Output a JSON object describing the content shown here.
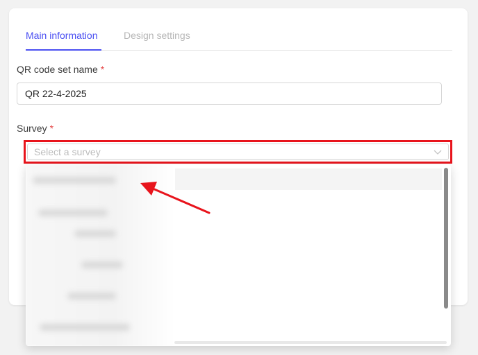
{
  "tabs": [
    {
      "label": "Main information",
      "active": true
    },
    {
      "label": "Design settings",
      "active": false
    }
  ],
  "fields": {
    "qr_name": {
      "label": "QR code set name",
      "required_mark": "*",
      "value": "QR 22-4-2025"
    },
    "survey": {
      "label": "Survey",
      "required_mark": "*",
      "placeholder": "Select a survey"
    }
  },
  "colors": {
    "accent": "#4a4ff2",
    "required": "#e54848",
    "highlight_box": "#e8141c"
  },
  "icons": {
    "select_chevron": "chevron-down-icon",
    "annotation": "red-arrow"
  }
}
